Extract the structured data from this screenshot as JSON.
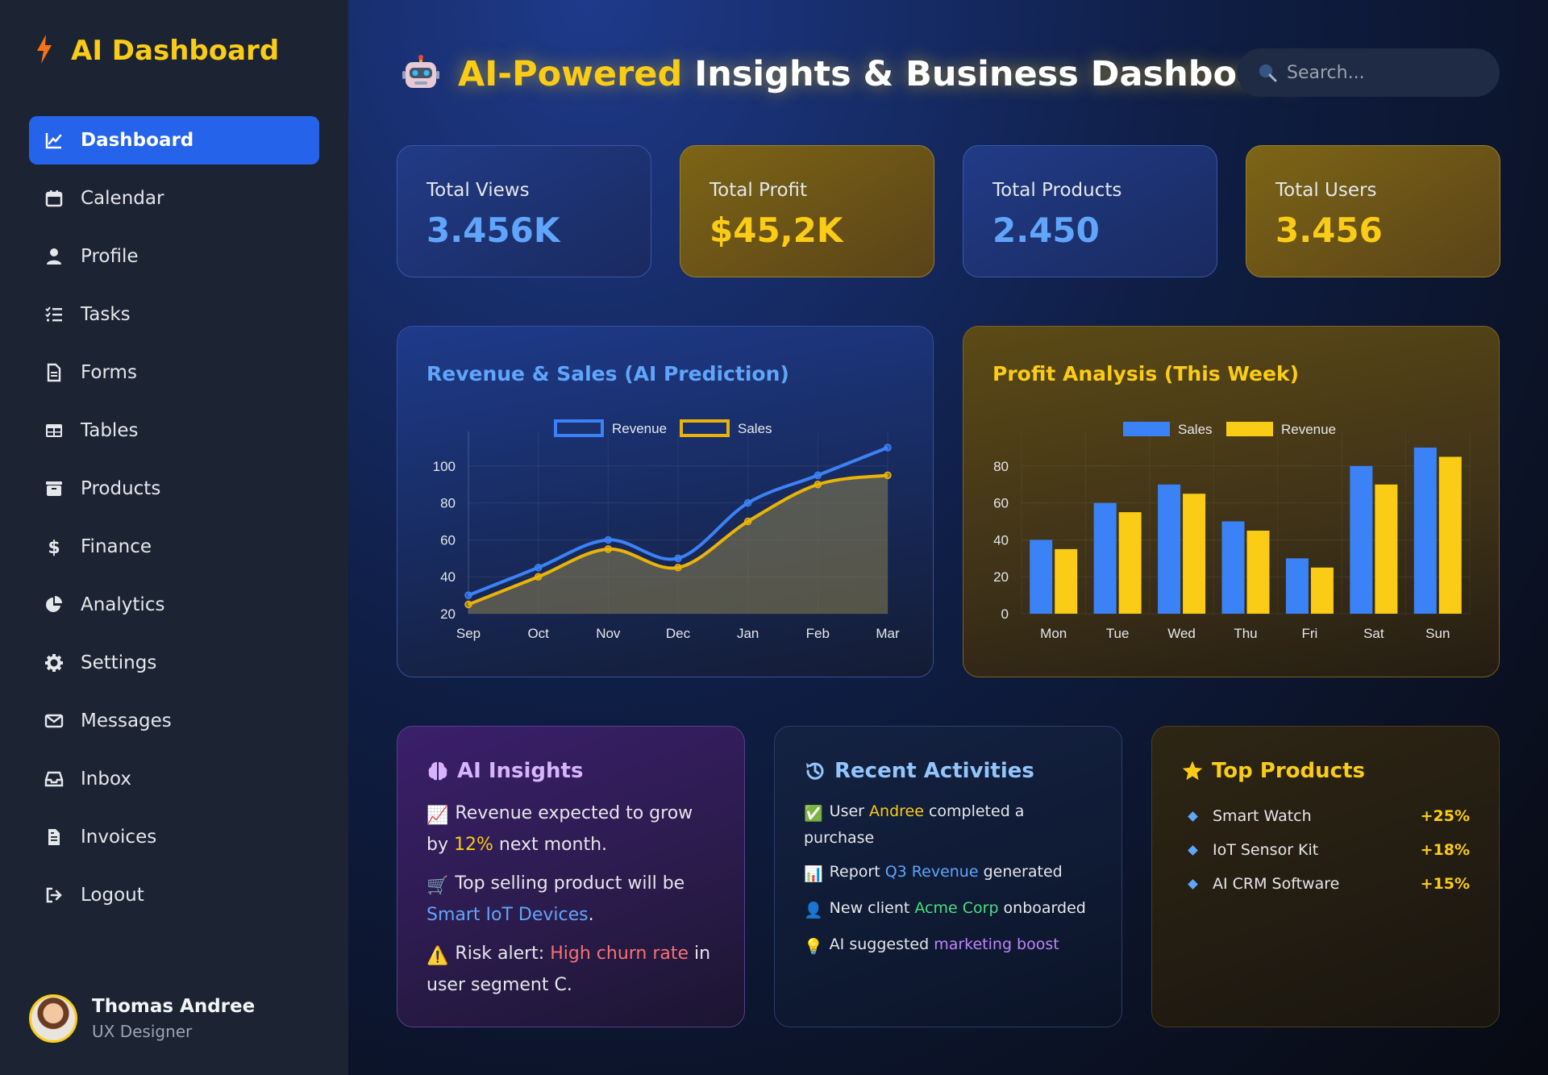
{
  "sidebar": {
    "brand_icon": "bolt-icon",
    "brand": "AI Dashboard",
    "items": [
      {
        "label": "Dashboard",
        "icon": "chart-line-icon",
        "active": true
      },
      {
        "label": "Calendar",
        "icon": "calendar-icon"
      },
      {
        "label": "Profile",
        "icon": "user-icon"
      },
      {
        "label": "Tasks",
        "icon": "list-check-icon"
      },
      {
        "label": "Forms",
        "icon": "file-icon"
      },
      {
        "label": "Tables",
        "icon": "table-icon"
      },
      {
        "label": "Products",
        "icon": "box-icon"
      },
      {
        "label": "Finance",
        "icon": "dollar-icon"
      },
      {
        "label": "Analytics",
        "icon": "pie-chart-icon"
      },
      {
        "label": "Settings",
        "icon": "gear-icon"
      },
      {
        "label": "Messages",
        "icon": "envelope-icon"
      },
      {
        "label": "Inbox",
        "icon": "inbox-icon"
      },
      {
        "label": "Invoices",
        "icon": "invoice-icon"
      },
      {
        "label": "Logout",
        "icon": "logout-icon"
      }
    ],
    "user": {
      "name": "Thomas Andree",
      "role": "UX Designer"
    }
  },
  "header": {
    "icon": "robot-icon",
    "title_highlight": "AI-Powered",
    "title_rest": "Insights & Business Dashboard",
    "search_placeholder": "Search..."
  },
  "stats": [
    {
      "label": "Total Views",
      "value": "3.456K",
      "theme": "blue"
    },
    {
      "label": "Total Profit",
      "value": "$45,2K",
      "theme": "gold"
    },
    {
      "label": "Total Products",
      "value": "2.450",
      "theme": "blue"
    },
    {
      "label": "Total Users",
      "value": "3.456",
      "theme": "gold"
    }
  ],
  "chart_data": [
    {
      "type": "line",
      "title": "Revenue & Sales (AI Prediction)",
      "categories": [
        "Sep",
        "Oct",
        "Nov",
        "Dec",
        "Jan",
        "Feb",
        "Mar"
      ],
      "series": [
        {
          "name": "Revenue",
          "values": [
            30,
            45,
            60,
            50,
            80,
            95,
            110
          ],
          "color": "#3b82f6"
        },
        {
          "name": "Sales",
          "values": [
            25,
            40,
            55,
            45,
            70,
            90,
            95
          ],
          "color": "#eab308"
        }
      ],
      "yticks": [
        20,
        40,
        60,
        80,
        100
      ],
      "ylim": [
        20,
        110
      ],
      "legend": "top-center",
      "grid": true
    },
    {
      "type": "bar",
      "title": "Profit Analysis (This Week)",
      "categories": [
        "Mon",
        "Tue",
        "Wed",
        "Thu",
        "Fri",
        "Sat",
        "Sun"
      ],
      "series": [
        {
          "name": "Sales",
          "values": [
            40,
            60,
            70,
            50,
            30,
            80,
            90
          ],
          "color": "#3b82f6"
        },
        {
          "name": "Revenue",
          "values": [
            35,
            55,
            65,
            45,
            25,
            70,
            85
          ],
          "color": "#facc15"
        }
      ],
      "yticks": [
        0,
        20,
        40,
        60,
        80
      ],
      "ylim": [
        0,
        90
      ],
      "legend": "top-center",
      "grid": true
    }
  ],
  "insights": {
    "title": "AI Insights",
    "icon": "brain-icon",
    "items": [
      {
        "icon": "📈",
        "pre": "Revenue expected to grow by ",
        "hl": "12%",
        "post": " next month.",
        "hl_color": "#facc15"
      },
      {
        "icon": "🛒",
        "pre": "Top selling product will be ",
        "hl": "Smart IoT Devices",
        "post": ".",
        "hl_color": "#60a5fa"
      },
      {
        "icon": "⚠️",
        "pre": "Risk alert: ",
        "hl": "High churn rate",
        "post": " in user segment C.",
        "hl_color": "#f87171"
      }
    ]
  },
  "activities": {
    "title": "Recent Activities",
    "icon": "history-icon",
    "items": [
      {
        "icon": "✅",
        "pre": "User ",
        "hl": "Andree",
        "post": " completed a purchase",
        "hl_color": "#facc15"
      },
      {
        "icon": "📊",
        "pre": "Report ",
        "hl": "Q3 Revenue",
        "post": " generated",
        "hl_color": "#60a5fa"
      },
      {
        "icon": "👤",
        "pre": "New client ",
        "hl": "Acme Corp",
        "post": " onboarded",
        "hl_color": "#4ade80"
      },
      {
        "icon": "💡",
        "pre": "AI suggested ",
        "hl": "marketing boost",
        "post": "",
        "hl_color": "#c084fc"
      }
    ]
  },
  "top_products": {
    "title": "Top Products",
    "icon": "star-icon",
    "items": [
      {
        "name": "Smart Watch",
        "change": "+25%"
      },
      {
        "name": "IoT Sensor Kit",
        "change": "+18%"
      },
      {
        "name": "AI CRM Software",
        "change": "+15%"
      }
    ]
  }
}
